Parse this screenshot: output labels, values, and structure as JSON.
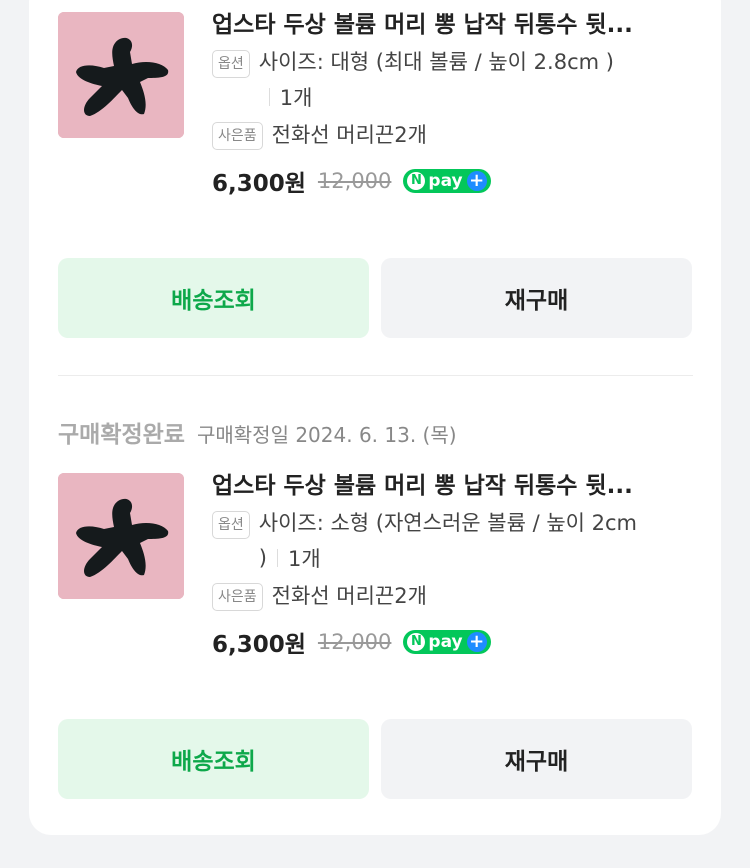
{
  "orders": [
    {
      "title": "업스타 두상 볼륨 머리 뽕 납작 뒤통수 뒷...",
      "option_tag": "옵션",
      "option_text": "사이즈: 대형 (최대 볼륨 / 높이 2.8cm )",
      "option_text_cont": "",
      "quantity": "1개",
      "gift_tag": "사은품",
      "gift_text": "전화선 머리끈2개",
      "price": "6,300원",
      "original_price": "12,000",
      "npay_label": "pay",
      "track_button": "배송조회",
      "rebuy_button": "재구매"
    },
    {
      "status": "구매확정완료",
      "status_date": "구매확정일 2024. 6. 13. (목)",
      "title": "업스타 두상 볼륨 머리 뽕 납작 뒤통수 뒷...",
      "option_tag": "옵션",
      "option_text": "사이즈: 소형 (자연스러운 볼륨 / 높이 2cm",
      "option_text_cont": ")",
      "quantity": "1개",
      "gift_tag": "사은품",
      "gift_text": "전화선 머리끈2개",
      "price": "6,300원",
      "original_price": "12,000",
      "npay_label": "pay",
      "track_button": "배송조회",
      "rebuy_button": "재구매"
    }
  ],
  "colors": {
    "accent_green": "#0da84a",
    "track_bg": "#e4f8ea",
    "npay_green": "#03c75a"
  }
}
